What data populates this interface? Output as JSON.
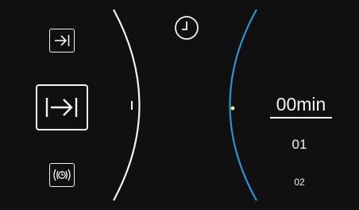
{
  "icons": {
    "skip_small": "arrow-to-bar-icon",
    "skip_large": "bar-arrow-to-bar-icon",
    "remote_start": "remote-clock-icon",
    "timer": "clock-icon"
  },
  "colors": {
    "background": "#101010",
    "foreground": "#f2f2f2",
    "accent": "#2b94d4",
    "indicator": "#e6f59a"
  },
  "time_picker": {
    "selected": "00min",
    "next_1": "01",
    "next_2": "02"
  }
}
